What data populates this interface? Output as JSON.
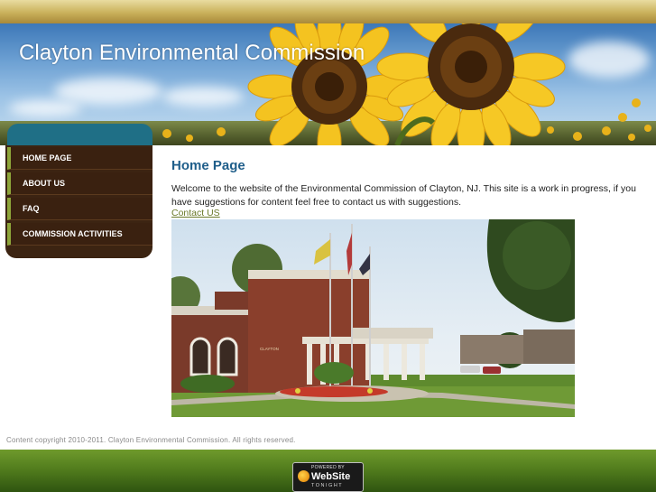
{
  "header": {
    "site_title": "Clayton Environmental Commission"
  },
  "nav": {
    "items": [
      {
        "label": "HOME PAGE"
      },
      {
        "label": "ABOUT US"
      },
      {
        "label": "FAQ"
      },
      {
        "label": "COMMISSION ACTIVITIES"
      }
    ]
  },
  "main": {
    "heading": "Home Page",
    "intro": "Welcome to the website of the Environmental Commission of Clayton, NJ. This site is a work in progress, if you have suggestions for content feel free to contact us with suggestions.",
    "contact_link": "Contact US",
    "photo_sign": "CLAYTON MUNICIPAL BUILDING"
  },
  "footer": {
    "copyright": "Content copyright 2010-2011. Clayton Environmental Commission. All rights reserved.",
    "badge": {
      "powered_by": "POWERED BY",
      "name": "WebSite",
      "tagline": "TONIGHT"
    }
  },
  "colors": {
    "heading_blue": "#1f5e8a",
    "nav_brown": "#3a2110",
    "nav_accent": "#8fa63a",
    "nav_cap_teal": "#1f6f86",
    "footer_green": "#4f7a1c",
    "link_green": "#6b7a2a"
  },
  "icons": [
    "sunflower-banner-image",
    "municipal-building-photo",
    "website-tonight-logo-icon"
  ]
}
